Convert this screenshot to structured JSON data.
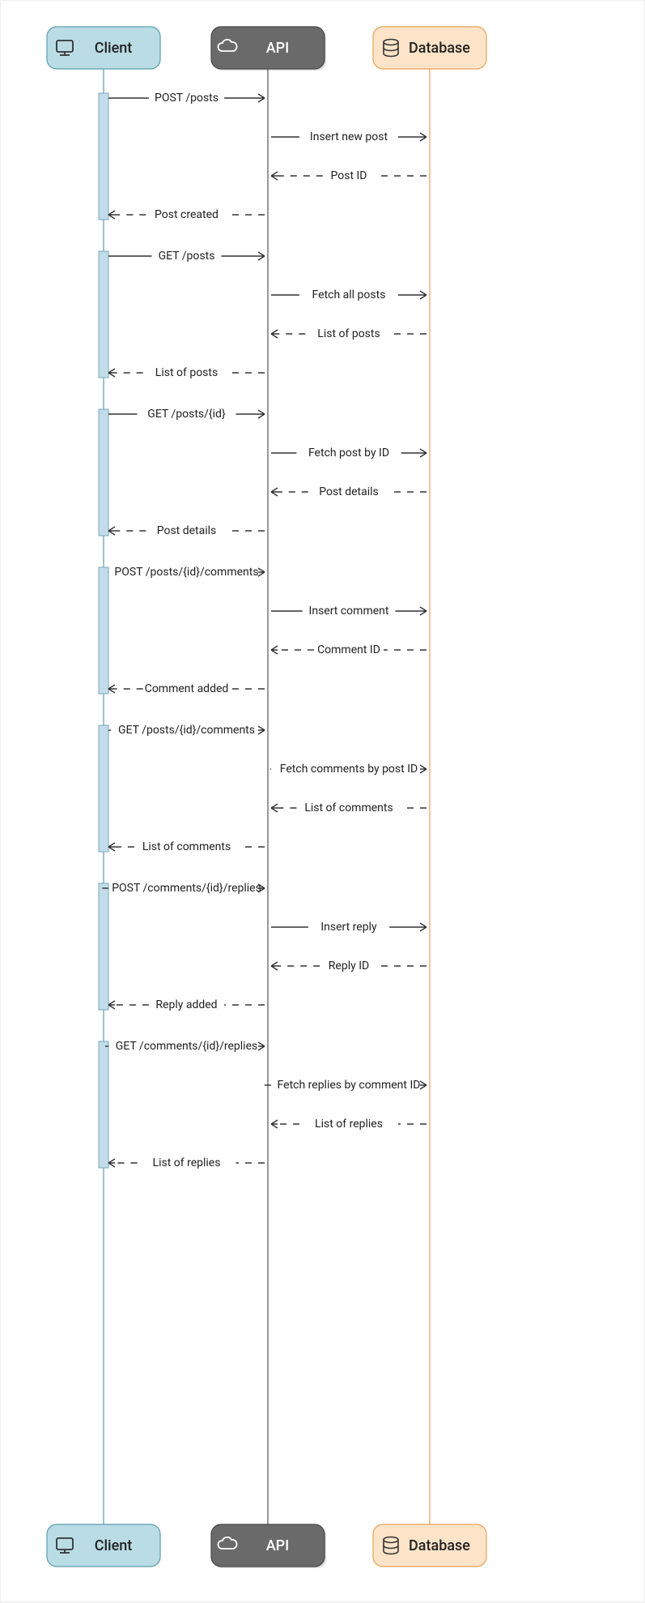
{
  "actors": {
    "client": {
      "label": "Client",
      "fill": "#b9dce5",
      "stroke": "#5c9cad"
    },
    "api": {
      "label": "API",
      "fill": "#6a6a6a",
      "stroke": "#4a4a4a",
      "textFill": "#ffffff"
    },
    "database": {
      "label": "Database",
      "fill": "#fde4c8",
      "stroke": "#e3a259"
    }
  },
  "sequences": [
    {
      "req": "POST /posts",
      "dbReq": "Insert new post",
      "dbRes": "Post ID",
      "res": "Post created"
    },
    {
      "req": "GET /posts",
      "dbReq": "Fetch all posts",
      "dbRes": "List of posts",
      "res": "List of posts"
    },
    {
      "req": "GET /posts/{id}",
      "dbReq": "Fetch post by ID",
      "dbRes": "Post details",
      "res": "Post details"
    },
    {
      "req": "POST /posts/{id}/comments",
      "dbReq": "Insert comment",
      "dbRes": "Comment ID",
      "res": "Comment added"
    },
    {
      "req": "GET /posts/{id}/comments",
      "dbReq": "Fetch comments by post ID",
      "dbRes": "List of comments",
      "res": "List of comments"
    },
    {
      "req": "POST /comments/{id}/replies",
      "dbReq": "Insert reply",
      "dbRes": "Reply ID",
      "res": "Reply added"
    },
    {
      "req": "GET /comments/{id}/replies",
      "dbReq": "Fetch replies by comment ID",
      "dbRes": "List of replies",
      "res": "List of replies"
    }
  ]
}
